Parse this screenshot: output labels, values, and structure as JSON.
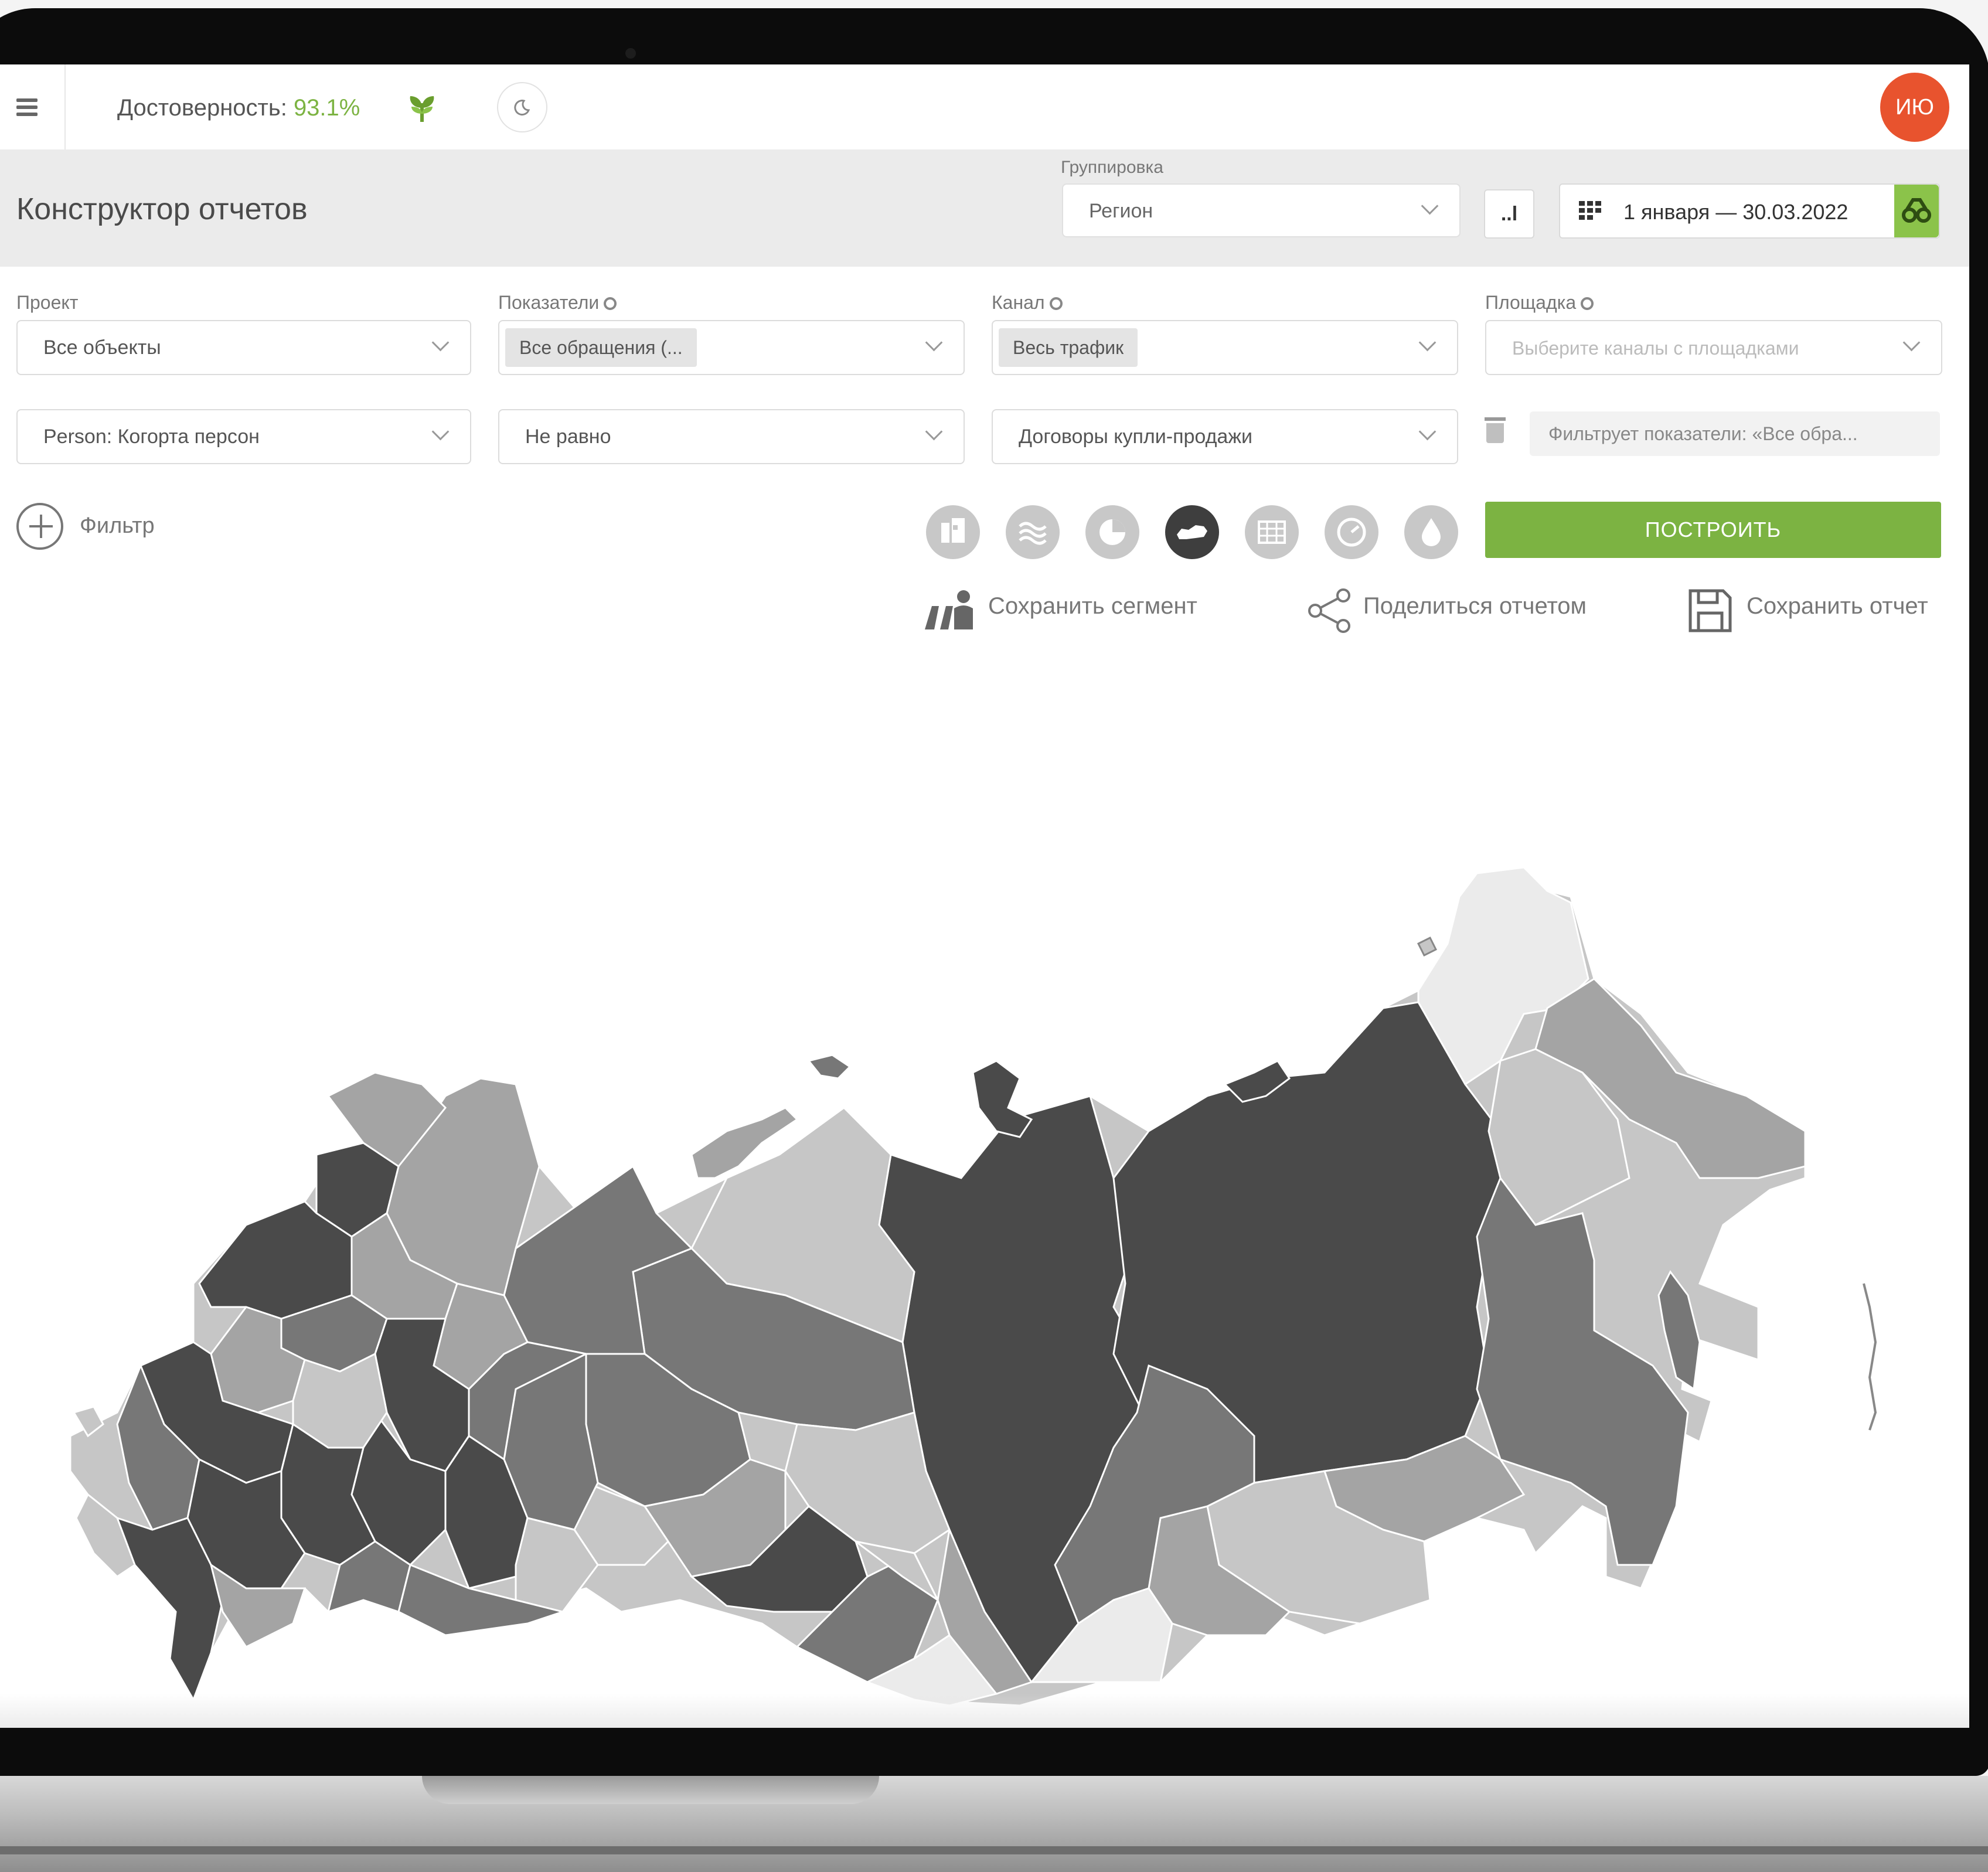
{
  "topbar": {
    "reliability_label": "Достоверность:",
    "reliability_value": "93.1%",
    "avatar_initials": "ИЮ"
  },
  "header": {
    "title": "Конструктор отчетов",
    "grouping_label": "Группировка",
    "grouping_value": "Регион",
    "bar_button": "..l",
    "date_range": "1 января — 30.03.2022"
  },
  "filters": {
    "project": {
      "label": "Проект",
      "value": "Все объекты"
    },
    "metrics": {
      "label": "Показатели",
      "value": "Все обращения (..."
    },
    "channel": {
      "label": "Канал",
      "value": "Весь трафик"
    },
    "site": {
      "label": "Площадка",
      "placeholder": "Выберите каналы с площадками"
    },
    "row2": {
      "field": "Person: Когорта персон",
      "operator": "Не равно",
      "value": "Договоры купли-продажи",
      "note": "Фильтрует показатели: «Все обра..."
    },
    "add_filter_label": "Фильтр"
  },
  "view_types": [
    {
      "icon": "funnel-chart-icon",
      "active": false
    },
    {
      "icon": "wave-chart-icon",
      "active": false
    },
    {
      "icon": "pie-chart-icon",
      "active": false
    },
    {
      "icon": "map-chart-icon",
      "active": true
    },
    {
      "icon": "table-icon",
      "active": false
    },
    {
      "icon": "gauge-icon",
      "active": false
    },
    {
      "icon": "drop-icon",
      "active": false
    }
  ],
  "build_button": "ПОСТРОИТЬ",
  "actions": {
    "save_segment": "Сохранить сегмент",
    "share_report": "Поделиться отчетом",
    "save_report": "Сохранить отчет"
  },
  "colors": {
    "accent_green": "#7cb342",
    "avatar_orange": "#e8532e",
    "map_shades": [
      "#4a4a4a",
      "#777777",
      "#a4a4a4",
      "#c6c6c6",
      "#ebebeb"
    ]
  }
}
